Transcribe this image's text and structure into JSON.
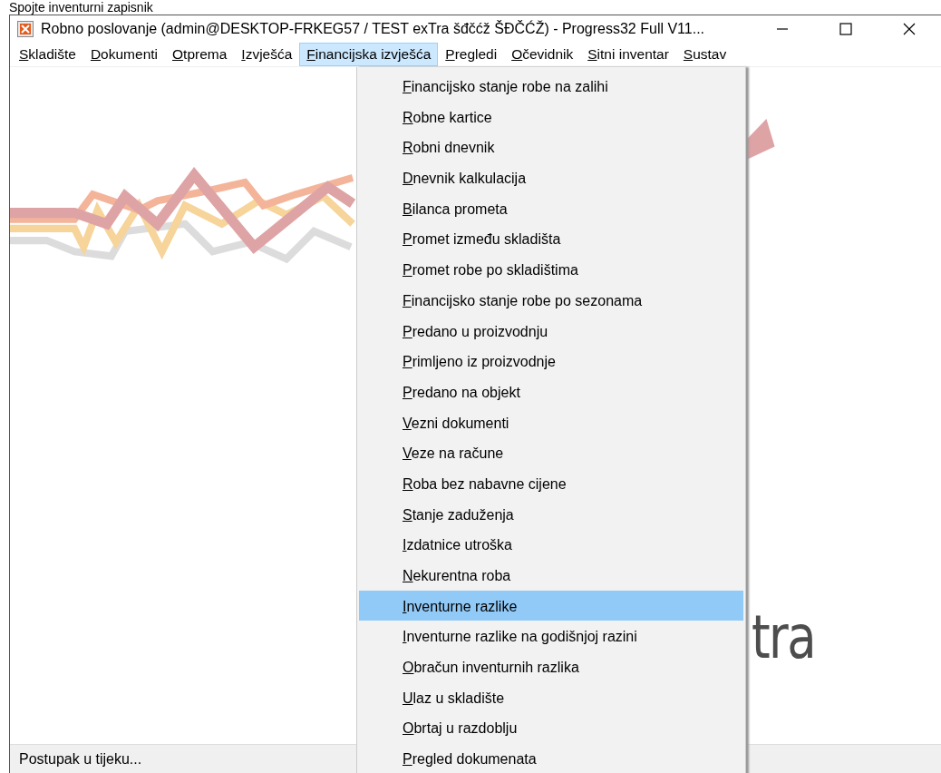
{
  "caption": "Spojte inventurni zapisnik",
  "window": {
    "title": "Robno poslovanje (admin@DESKTOP-FRKEG57 / TEST exTra šđčćž ŠĐČĆŽ) - Progress32 Full V11..."
  },
  "menu_bar": [
    {
      "label": "Skladište",
      "selected": false
    },
    {
      "label": "Dokumenti",
      "selected": false
    },
    {
      "label": "Otprema",
      "selected": false
    },
    {
      "label": "Izvješća",
      "selected": false
    },
    {
      "label": "Financijska izvješća",
      "selected": true
    },
    {
      "label": "Pregledi",
      "selected": false
    },
    {
      "label": "Očevidnik",
      "selected": false
    },
    {
      "label": "Sitni inventar",
      "selected": false
    },
    {
      "label": "Sustav",
      "selected": false
    }
  ],
  "dropdown": {
    "items": [
      {
        "label": "Financijsko stanje robe na zalihi",
        "selected": false
      },
      {
        "label": "Robne kartice",
        "selected": false
      },
      {
        "label": "Robni dnevnik",
        "selected": false
      },
      {
        "label": "Dnevnik kalkulacija",
        "selected": false
      },
      {
        "label": "Bilanca prometa",
        "selected": false
      },
      {
        "label": "Promet između skladišta",
        "selected": false
      },
      {
        "label": "Promet robe po skladištima",
        "selected": false
      },
      {
        "label": "Financijsko stanje robe po sezonama",
        "selected": false
      },
      {
        "label": "Predano u proizvodnju",
        "selected": false
      },
      {
        "label": "Primljeno iz proizvodnje",
        "selected": false
      },
      {
        "label": "Predano na objekt",
        "selected": false
      },
      {
        "label": "Vezni dokumenti",
        "selected": false
      },
      {
        "label": "Veze na račune",
        "selected": false
      },
      {
        "label": "Roba bez nabavne cijene",
        "selected": false
      },
      {
        "label": "Stanje zaduženja",
        "selected": false
      },
      {
        "label": "Izdatnice utroška",
        "selected": false
      },
      {
        "label": "Nekurentna roba",
        "selected": false
      },
      {
        "label": "Inventurne razlike",
        "selected": true
      },
      {
        "label": "Inventurne razlike na godišnjoj razini",
        "selected": false
      },
      {
        "label": "Obračun inventurnih razlika",
        "selected": false
      },
      {
        "label": "Ulaz u skladište",
        "selected": false
      },
      {
        "label": "Obrtaj u razdoblju",
        "selected": false
      },
      {
        "label": "Pregled dokumenata",
        "selected": false
      }
    ]
  },
  "logo_text": "tra",
  "status_bar": "Postupak u tijeku..."
}
